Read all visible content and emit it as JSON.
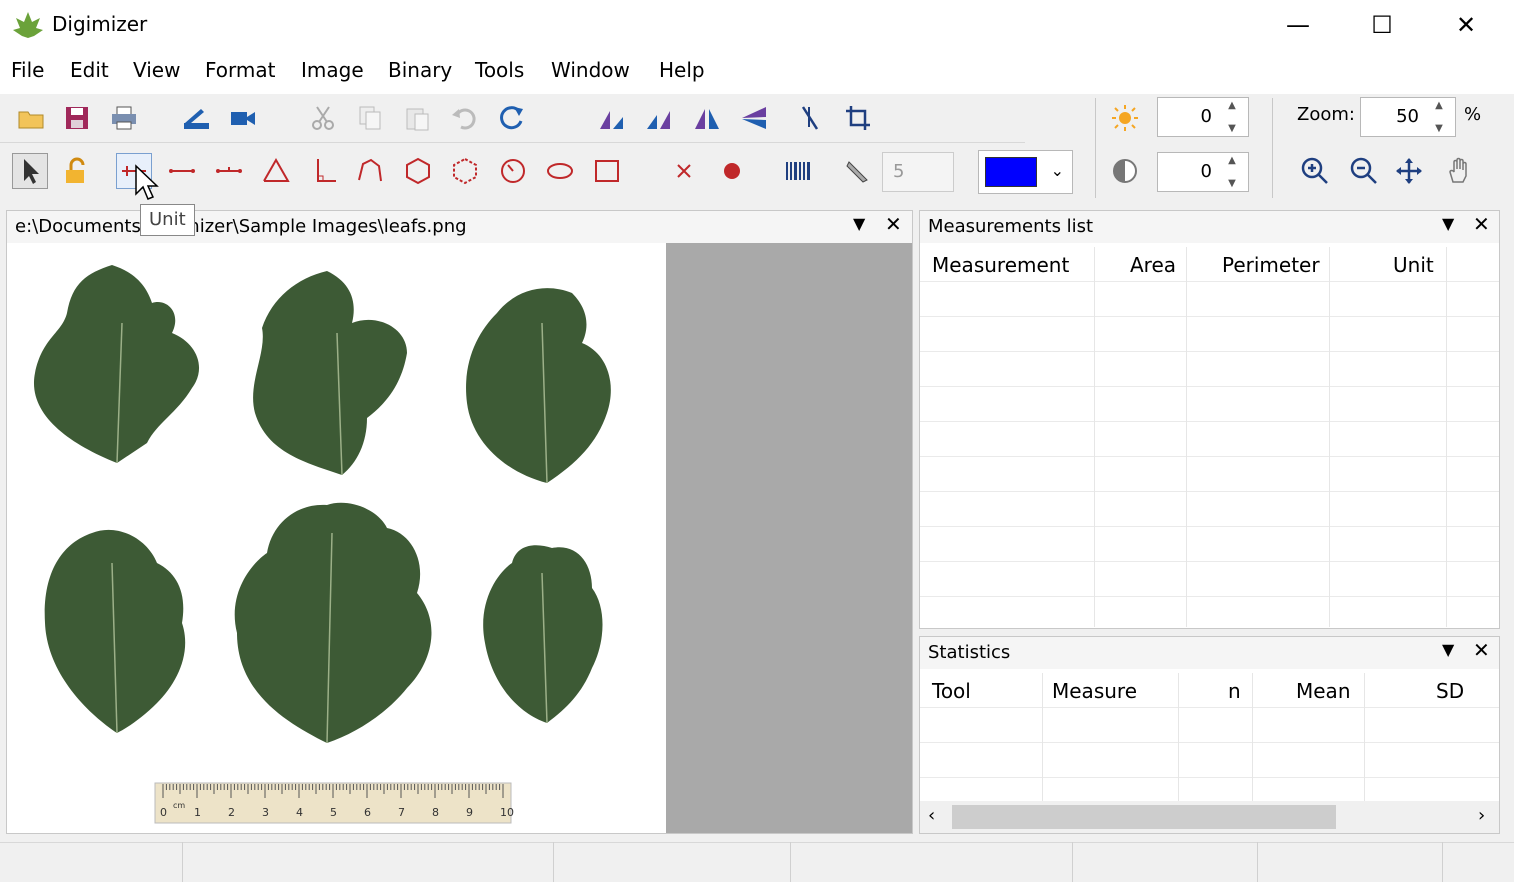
{
  "window": {
    "title": "Digimizer",
    "min_glyph": "—",
    "max_glyph": "☐",
    "close_glyph": "✕"
  },
  "menu": [
    "File",
    "Edit",
    "View",
    "Format",
    "Image",
    "Binary",
    "Tools",
    "Window",
    "Help"
  ],
  "toolbar": {
    "row1_icons": [
      "open-folder-icon",
      "save-icon",
      "print-icon",
      "scanner-icon",
      "video-camera-icon",
      "cut-icon",
      "copy-icon",
      "paste-icon",
      "undo-icon",
      "redo-icon",
      "rotate-left-icon",
      "rotate-right-icon",
      "flip-horizontal-icon",
      "flip-vertical-icon",
      "calibrate-icon",
      "crop-icon"
    ],
    "row2_icons": [
      "pointer-icon",
      "lock-icon",
      "unit-tool-icon",
      "line-tool-icon",
      "multiline-tool-icon",
      "angle-tool-icon",
      "right-angle-tool-icon",
      "polyline-tool-icon",
      "polygon-tool-icon",
      "polygon-dotted-tool-icon",
      "circle-tool-icon",
      "ellipse-tool-icon",
      "rectangle-tool-icon",
      "marker-x-icon",
      "marker-dot-icon",
      "barcode-icon",
      "pencil-icon"
    ],
    "pen_width": "5",
    "color_swatch": "#0000ff",
    "brightness": "0",
    "contrast": "0",
    "zoom_label": "Zoom:",
    "zoom_value": "50",
    "zoom_unit": "%"
  },
  "tooltip": "Unit",
  "image_panel": {
    "path": "e:\\Documents\\Digimizer\\Sample Images\\leafs.png",
    "ruler_numbers": [
      "0",
      "1",
      "2",
      "3",
      "4",
      "5",
      "6",
      "7",
      "8",
      "9",
      "10"
    ],
    "ruler_unit": "cm"
  },
  "measurements_panel": {
    "title": "Measurements list",
    "columns": [
      "Measurement",
      "Area",
      "Perimeter",
      "Unit"
    ]
  },
  "statistics_panel": {
    "title": "Statistics",
    "columns": [
      "Tool",
      "Measure",
      "n",
      "Mean",
      "SD"
    ]
  },
  "colors": {
    "accent": "#0000ff",
    "leaf": "#3d5a35",
    "gray_area": "#a9a9a9"
  }
}
